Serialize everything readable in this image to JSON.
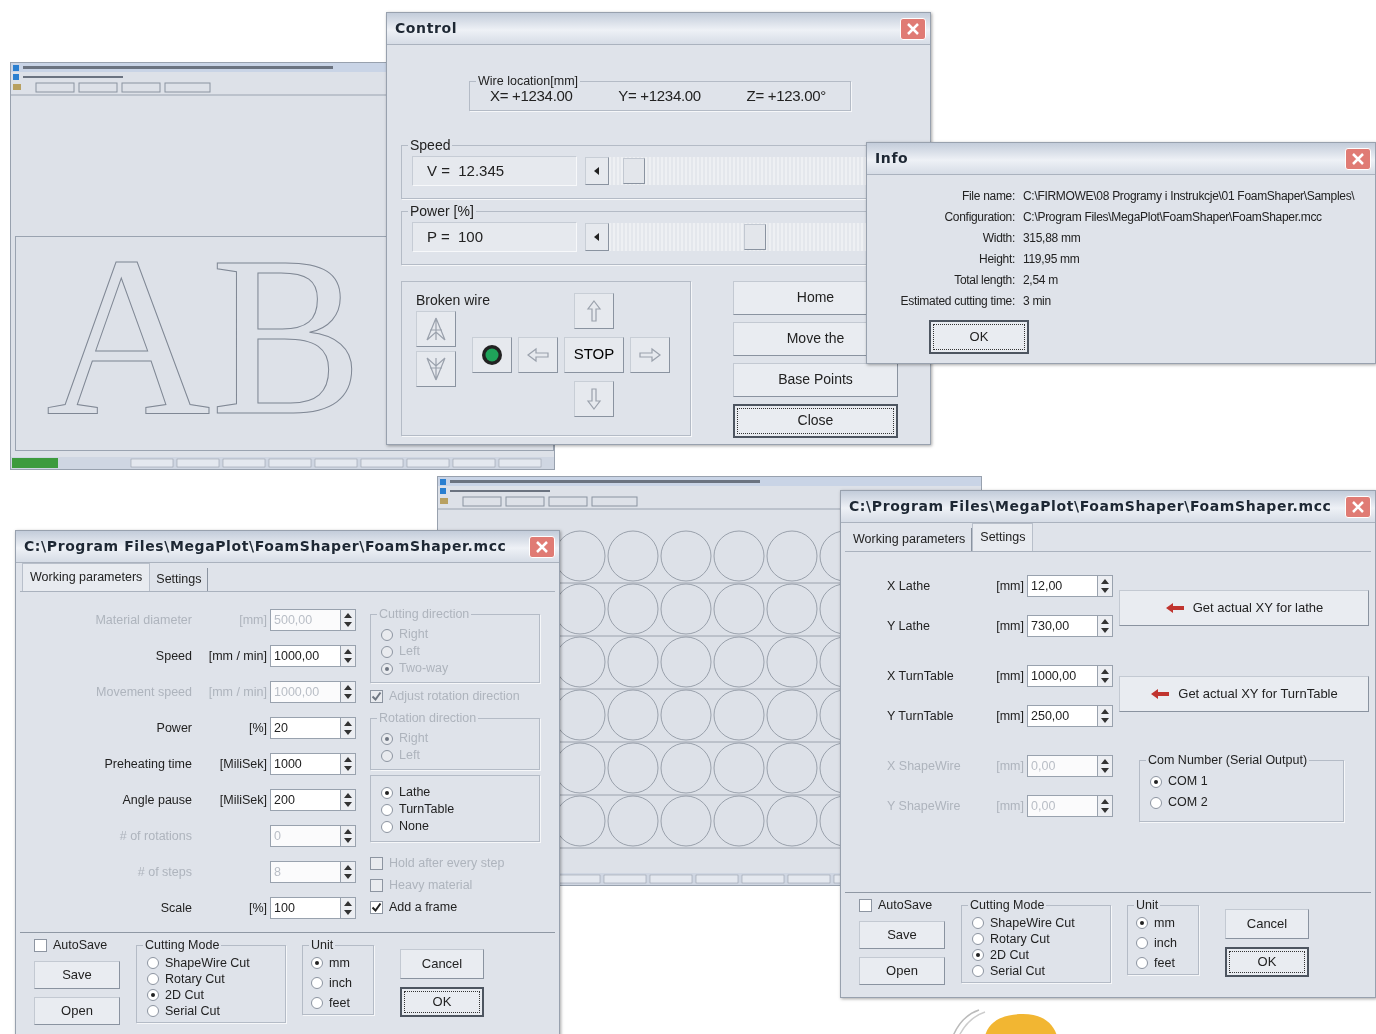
{
  "cad_window": {
    "preview_text": "AB"
  },
  "control": {
    "title": "Control",
    "wire_location": {
      "label": "Wire location[mm]",
      "values": [
        "X= +1234.00",
        "Y= +1234.00",
        "Z= +123.00°"
      ]
    },
    "sliders": [
      {
        "label": "Speed",
        "reading": "V =  12.345",
        "level": 0.06
      },
      {
        "label": "Power [%]",
        "reading": "P =  100",
        "level": 0.57
      }
    ],
    "broken_wire": {
      "label": "Broken wire",
      "lamp_on": true
    },
    "stop": "STOP",
    "buttons": [
      {
        "label": "Home",
        "default": false
      },
      {
        "label": "Move the",
        "default": false
      },
      {
        "label": "Base Points",
        "default": false
      },
      {
        "label": "Close",
        "default": true
      }
    ]
  },
  "info": {
    "title": "Info",
    "rows": [
      {
        "label": "File name:",
        "value": "C:\\FIRMOWE\\08 Programy i Instrukcje\\01 FoamShaper\\Samples\\"
      },
      {
        "label": "Configuration:",
        "value": "C:\\Program Files\\MegaPlot\\FoamShaper\\FoamShaper.mcc"
      },
      {
        "label": "Width:",
        "value": "315,88 mm"
      },
      {
        "label": "Height:",
        "value": "119,95 mm"
      },
      {
        "label": "Total length:",
        "value": "2,54 m"
      },
      {
        "label": "Estimated cutting time:",
        "value": "3 min"
      }
    ],
    "ok": {
      "label": "OK",
      "default": true
    }
  },
  "working_dialog": {
    "title": "C:\\Program Files\\MegaPlot\\FoamShaper\\FoamShaper.mcc",
    "tabs": [
      {
        "label": "Working parameters",
        "selected": true
      },
      {
        "label": "Settings",
        "selected": false
      }
    ],
    "fields": [
      {
        "label": "Material diameter",
        "unit": "[mm]",
        "value": "500,00",
        "disabled": true
      },
      {
        "label": "Speed",
        "unit": "[mm / min]",
        "value": "1000,00",
        "disabled": false
      },
      {
        "label": "Movement speed",
        "unit": "[mm / min]",
        "value": "1000,00",
        "disabled": true
      },
      {
        "label": "Power",
        "unit": "[%]",
        "value": "20",
        "disabled": false
      },
      {
        "label": "Preheating time",
        "unit": "[MiliSek]",
        "value": "1000",
        "disabled": false
      },
      {
        "label": "Angle pause",
        "unit": "[MiliSek]",
        "value": "200",
        "disabled": false
      },
      {
        "label": "# of rotations",
        "value": "0",
        "disabled": true
      },
      {
        "label": "# of steps",
        "value": "8",
        "disabled": true
      },
      {
        "label": "Scale",
        "unit": "[%]",
        "value": "100",
        "disabled": false
      }
    ],
    "side": [
      {
        "kind": "group",
        "label": "Cutting direction",
        "disabled": true,
        "options": [
          {
            "label": "Right",
            "selected": false
          },
          {
            "label": "Left",
            "selected": false
          },
          {
            "label": "Two-way",
            "selected": true
          }
        ]
      },
      {
        "kind": "check",
        "label": "Adjust rotation direction",
        "checked": true,
        "disabled": true
      },
      {
        "kind": "group",
        "label": "Rotation direction",
        "disabled": true,
        "options": [
          {
            "label": "Right",
            "selected": true
          },
          {
            "label": "Left",
            "selected": false
          }
        ]
      },
      {
        "kind": "group",
        "disabled": false,
        "options": [
          {
            "label": "Lathe",
            "selected": true
          },
          {
            "label": "TurnTable",
            "selected": false
          },
          {
            "label": "None",
            "selected": false
          }
        ]
      },
      {
        "kind": "check",
        "label": "Hold after every step",
        "checked": false,
        "disabled": true
      },
      {
        "kind": "check",
        "label": "Heavy material",
        "checked": false,
        "disabled": true
      },
      {
        "kind": "check",
        "label": "Add a frame",
        "checked": true,
        "disabled": false
      }
    ],
    "footer": {
      "autosave": {
        "label": "AutoSave",
        "checked": false
      },
      "buttons": [
        "Save",
        "Open"
      ],
      "cutting_mode": {
        "label": "Cutting Mode",
        "options": [
          {
            "label": "ShapeWire Cut",
            "selected": false
          },
          {
            "label": "Rotary Cut",
            "selected": false
          },
          {
            "label": "2D Cut",
            "selected": true
          },
          {
            "label": "Serial Cut",
            "selected": false
          }
        ]
      },
      "unit": {
        "label": "Unit",
        "options": [
          {
            "label": "mm",
            "selected": true
          },
          {
            "label": "inch",
            "selected": false
          },
          {
            "label": "feet",
            "selected": false
          }
        ]
      },
      "actions": [
        {
          "label": "Cancel",
          "default": false
        },
        {
          "label": "OK",
          "default": true
        }
      ]
    }
  },
  "settings_dialog": {
    "title": "C:\\Program Files\\MegaPlot\\FoamShaper\\FoamShaper.mcc",
    "tabs": [
      {
        "label": "Working parameters",
        "selected": false
      },
      {
        "label": "Settings",
        "selected": true
      }
    ],
    "fields": [
      {
        "label": "X Lathe",
        "unit": "[mm]",
        "value": "12,00",
        "disabled": false
      },
      {
        "label": "Y Lathe",
        "unit": "[mm]",
        "value": "730,00",
        "disabled": false
      },
      {
        "label": "X TurnTable",
        "unit": "[mm]",
        "value": "1000,00",
        "disabled": false
      },
      {
        "label": "Y TurnTable",
        "unit": "[mm]",
        "value": "250,00",
        "disabled": false
      },
      {
        "label": "X ShapeWire",
        "unit": "[mm]",
        "value": "0,00",
        "disabled": true
      },
      {
        "label": "Y ShapeWire",
        "unit": "[mm]",
        "value": "0,00",
        "disabled": true
      }
    ],
    "side": [
      {
        "kind": "button",
        "label": "Get actual XY for lathe"
      },
      {
        "kind": "button",
        "label": "Get actual XY for TurnTable"
      },
      {
        "kind": "group",
        "label": "Com Number (Serial Output)",
        "disabled": false,
        "options": [
          {
            "label": "COM 1",
            "selected": true
          },
          {
            "label": "COM 2",
            "selected": false
          }
        ]
      }
    ],
    "footer": {
      "autosave": {
        "label": "AutoSave",
        "checked": false
      },
      "buttons": [
        "Save",
        "Open"
      ],
      "cutting_mode": {
        "label": "Cutting Mode",
        "options": [
          {
            "label": "ShapeWire Cut",
            "selected": false
          },
          {
            "label": "Rotary Cut",
            "selected": false
          },
          {
            "label": "2D Cut",
            "selected": true
          },
          {
            "label": "Serial Cut",
            "selected": false
          }
        ]
      },
      "unit": {
        "label": "Unit",
        "options": [
          {
            "label": "mm",
            "selected": true
          },
          {
            "label": "inch",
            "selected": false
          },
          {
            "label": "feet",
            "selected": false
          }
        ]
      },
      "actions": [
        {
          "label": "Cancel",
          "default": false
        },
        {
          "label": "OK",
          "default": true
        }
      ]
    }
  }
}
